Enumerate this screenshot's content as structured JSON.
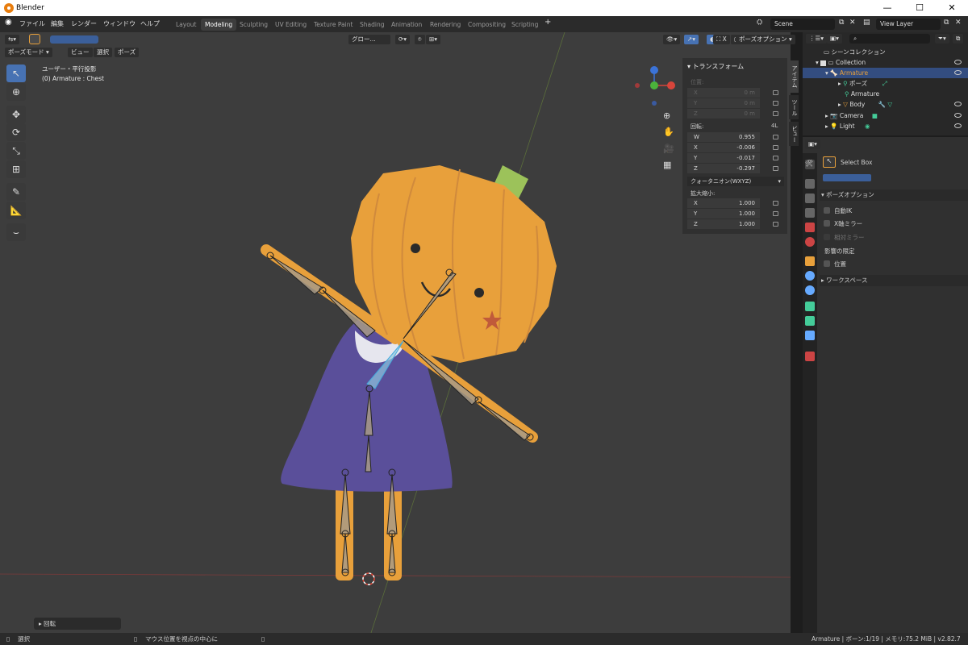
{
  "window": {
    "title": "Blender"
  },
  "menu": {
    "items": [
      "ファイル",
      "編集",
      "レンダー",
      "ウィンドウ",
      "ヘルプ"
    ]
  },
  "workspaces": [
    "Layout",
    "Modeling",
    "Sculpting",
    "UV Editing",
    "Texture Paint",
    "Shading",
    "Animation",
    "Rendering",
    "Compositing",
    "Scripting"
  ],
  "active_workspace": "Modeling",
  "scene": {
    "name": "Scene",
    "view_layer": "View Layer"
  },
  "viewport": {
    "mode": "ポーズモード",
    "menus": [
      "ビュー",
      "選択",
      "ポーズ"
    ],
    "transform_orientation": "グロー...",
    "pose_options": "ポーズオプション",
    "info_line1": "ユーザー・平行投影",
    "info_line2": "(0) Armature : Chest",
    "last_op": "回転"
  },
  "npanel": {
    "title": "トランスフォーム",
    "location_label": "位置:",
    "location": [
      {
        "axis": "X",
        "value": "0 m"
      },
      {
        "axis": "Y",
        "value": "0 m"
      },
      {
        "axis": "Z",
        "value": "0 m"
      }
    ],
    "rotation_label": "回転:",
    "rotation_mode_short": "4L",
    "rotation": [
      {
        "axis": "W",
        "value": "0.955"
      },
      {
        "axis": "X",
        "value": "-0.006"
      },
      {
        "axis": "Y",
        "value": "-0.017"
      },
      {
        "axis": "Z",
        "value": "-0.297"
      }
    ],
    "rotation_mode": "クォータニオン(WXYZ)",
    "scale_label": "拡大縮小:",
    "scale": [
      {
        "axis": "X",
        "value": "1.000"
      },
      {
        "axis": "Y",
        "value": "1.000"
      },
      {
        "axis": "Z",
        "value": "1.000"
      }
    ],
    "side_tabs": [
      "アイテム",
      "ツール",
      "ビュー"
    ]
  },
  "outliner": {
    "root": "シーンコレクション",
    "collection": "Collection",
    "armature": "Armature",
    "pose": "ポーズ",
    "armature_data": "Armature",
    "body": "Body",
    "camera": "Camera",
    "light": "Light"
  },
  "properties": {
    "tool_name": "Select Box",
    "pose_options_header": "ポーズオプション",
    "auto_ik": "自動IK",
    "x_mirror": "X軸ミラー",
    "relative_mirror": "相対ミラー",
    "affect_only": "影響の限定",
    "location_only": "位置",
    "workspace": "ワークスペース"
  },
  "statusbar": {
    "select": "選択",
    "center_view": "マウス位置を視点の中心に",
    "info": "Armature | ボーン:1/19 | メモリ:75.2 MiB | v2.82.7"
  },
  "gizmo": {
    "x": "X",
    "y": "Y",
    "z": "Z"
  },
  "colors": {
    "accent": "#4772b3",
    "pumpkin": "#e8a03b",
    "dress": "#5a4f9a",
    "selected_row": "#334d80"
  }
}
